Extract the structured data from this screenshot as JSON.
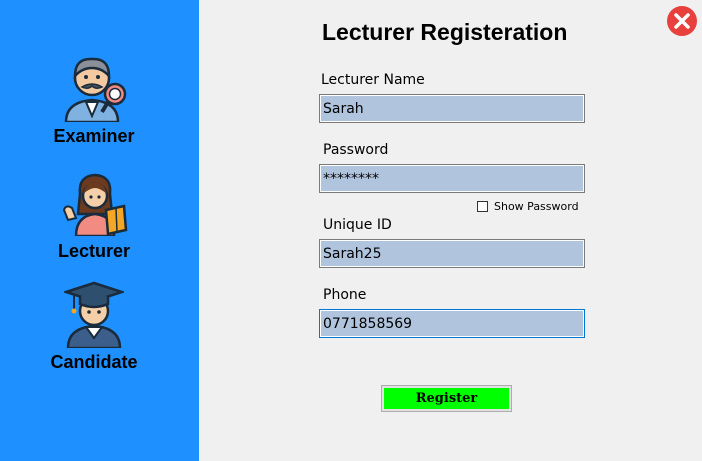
{
  "sidebar": {
    "items": [
      {
        "label": "Examiner",
        "icon": "examiner-icon"
      },
      {
        "label": "Lecturer",
        "icon": "lecturer-icon"
      },
      {
        "label": "Candidate",
        "icon": "candidate-icon"
      }
    ]
  },
  "form": {
    "title": "Lecturer Registeration",
    "fields": [
      {
        "label": "Lecturer Name",
        "value": "Sarah"
      },
      {
        "label": "Password",
        "value": "********"
      },
      {
        "label": "Unique ID",
        "value": "Sarah25"
      },
      {
        "label": "Phone",
        "value": "0771858569"
      }
    ],
    "show_password_label": "Show Password",
    "register_label": "Register"
  },
  "colors": {
    "sidebar": "#1e90ff",
    "field_bg": "#b0c4de",
    "register_bg": "#00ff00",
    "close": "#e8403c"
  },
  "icons": {
    "close": "close-icon"
  }
}
